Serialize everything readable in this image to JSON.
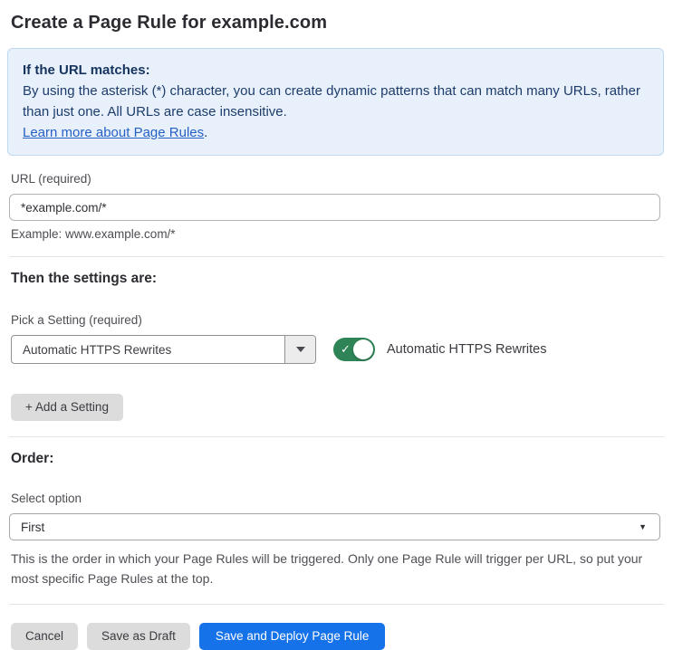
{
  "page": {
    "title": "Create a Page Rule for example.com"
  },
  "info_box": {
    "heading": "If the URL matches:",
    "body": "By using the asterisk (*) character, you can create dynamic patterns that can match many URLs, rather than just one. All URLs are case insensitive.",
    "link_label": "Learn more about Page Rules",
    "link_suffix": "."
  },
  "url_field": {
    "label": "URL (required)",
    "value": "*example.com/*",
    "helper": "Example: www.example.com/*"
  },
  "settings_section": {
    "heading": "Then the settings are:",
    "picker_label": "Pick a Setting (required)",
    "selected_setting": "Automatic HTTPS Rewrites",
    "toggle_label": "Automatic HTTPS Rewrites",
    "toggle_state": "on",
    "add_setting_label": "+ Add a Setting"
  },
  "order_section": {
    "heading": "Order:",
    "select_label": "Select option",
    "selected_option": "First",
    "helper": "This is the order in which your Page Rules will be triggered. Only one Page Rule will trigger per URL, so put your most specific Page Rules at the top."
  },
  "actions": {
    "cancel": "Cancel",
    "save_draft": "Save as Draft",
    "save_deploy": "Save and Deploy Page Rule"
  },
  "icons": {
    "dropdown_caret": "caret-down",
    "toggle_check": "✓",
    "select_caret": "▼"
  },
  "colors": {
    "accent_blue": "#1672e8",
    "info_background": "#e8f1fb",
    "info_border": "#bed8f2",
    "info_text": "#1d3c6b",
    "link_blue": "#2560c4",
    "toggle_green": "#2e8456",
    "button_gray": "#dcdcdd"
  }
}
